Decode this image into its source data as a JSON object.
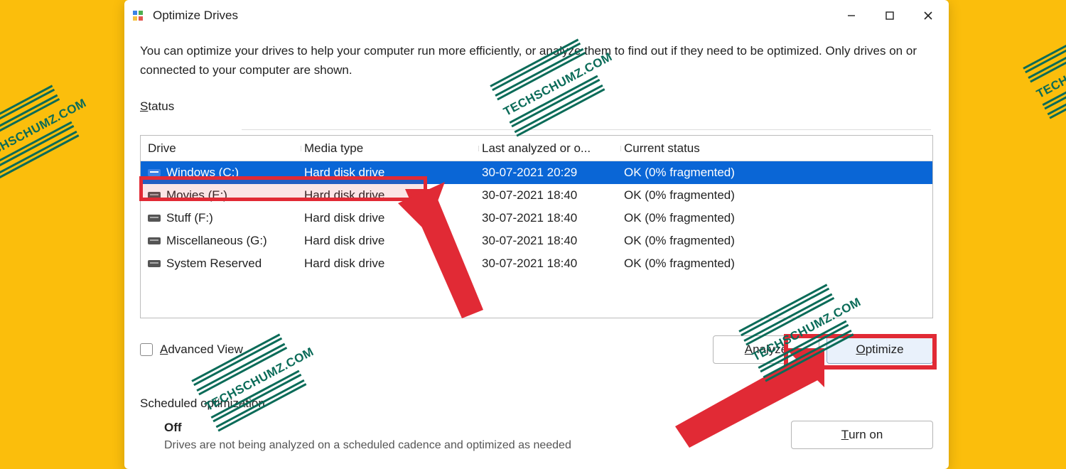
{
  "window": {
    "title": "Optimize Drives",
    "description": "You can optimize your drives to help your computer run more efficiently, or analyze them to find out if they need to be optimized. Only drives on or connected to your computer are shown."
  },
  "status_label_html": "Status",
  "status_label_underline": "S",
  "status_label_rest": "tatus",
  "columns": {
    "c1": "Drive",
    "c2": "Media type",
    "c3": "Last analyzed or o...",
    "c4": "Current status"
  },
  "drives": [
    {
      "name": "Windows (C:)",
      "media": "Hard disk drive",
      "last": "30-07-2021 20:29",
      "status": "OK (0% fragmented)",
      "selected": true,
      "icon": "c"
    },
    {
      "name": "Movies (E:)",
      "media": "Hard disk drive",
      "last": "30-07-2021 18:40",
      "status": "OK (0% fragmented)",
      "selected": false,
      "icon": "g"
    },
    {
      "name": "Stuff (F:)",
      "media": "Hard disk drive",
      "last": "30-07-2021 18:40",
      "status": "OK (0% fragmented)",
      "selected": false,
      "icon": "g"
    },
    {
      "name": "Miscellaneous (G:)",
      "media": "Hard disk drive",
      "last": "30-07-2021 18:40",
      "status": "OK (0% fragmented)",
      "selected": false,
      "icon": "g"
    },
    {
      "name": "System Reserved",
      "media": "Hard disk drive",
      "last": "30-07-2021 18:40",
      "status": "OK (0% fragmented)",
      "selected": false,
      "icon": "g"
    }
  ],
  "advanced_view_text": "dvanced View",
  "advanced_view_u": "A",
  "buttons": {
    "analyze_u": "A",
    "analyze_rest": "nalyze",
    "optimize_u": "O",
    "optimize_rest": "ptimize",
    "turn_on_u": "T",
    "turn_on_rest": "urn on"
  },
  "scheduled": {
    "heading": "Scheduled optimization",
    "state": "Off",
    "sub": "Drives are not being analyzed on a scheduled cadence and optimized as needed"
  },
  "watermark": "TECHSCHUMZ.COM",
  "annotations": {
    "highlight_row": "Windows (C:) row",
    "highlight_button": "Optimize button"
  }
}
